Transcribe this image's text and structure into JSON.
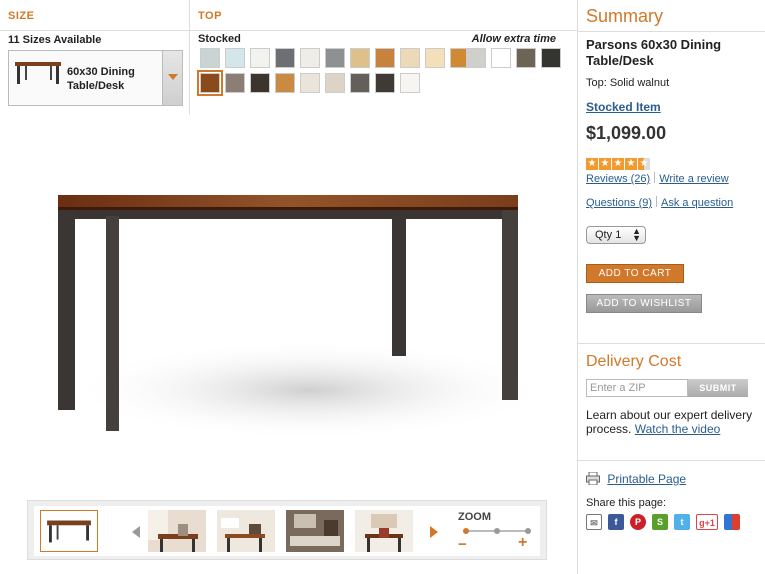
{
  "size": {
    "heading": "SIZE",
    "sub": "11 Sizes Available",
    "selected": "60x30 Dining Table/Desk"
  },
  "top": {
    "heading": "TOP",
    "stocked_label": "Stocked",
    "extra_label": "Allow extra time",
    "swatch_colors_row1": [
      "#c9d4d4",
      "#d3e6ea",
      "#f2f2ee",
      "#6d6f72",
      "#efede8",
      "#8e9194",
      "#e0c08a",
      "#c9823c",
      "#ecd9b5",
      "#f3dfb8",
      "#d08a34"
    ],
    "swatch_colors_row2": [
      "#8b4a1c",
      "#8c7e76",
      "#3d342e",
      "#c98a44",
      "#ebe4da",
      "#ddd4c7",
      "#63605c",
      "#3f3a36",
      "#f7f5f2"
    ],
    "swatch_colors_extra": [
      "#cfcfcb",
      "#ffffff",
      "#6d6455",
      "#343430"
    ]
  },
  "summary": {
    "heading": "Summary",
    "title": "Parsons 60x30 Dining Table/Desk",
    "top_info": "Top:  Solid walnut",
    "stocked_item": "Stocked Item",
    "price": "$1,099.00",
    "rating": 4.5,
    "reviews": "Reviews (26)",
    "write_review": "Write a review",
    "questions": "Questions (9)",
    "ask_question": "Ask a question",
    "qty_label": "Qty",
    "qty_value": "1",
    "add_to_cart": "ADD TO CART",
    "add_to_wishlist": "ADD TO WISHLIST"
  },
  "delivery": {
    "heading": "Delivery Cost",
    "zip_placeholder": "Enter a ZIP",
    "submit": "SUBMIT",
    "learn_text": "Learn about our expert delivery process.",
    "watch_link": "Watch the video"
  },
  "share": {
    "printable": "Printable Page",
    "label": "Share this page:",
    "icons": [
      "mail-icon",
      "facebook-icon",
      "pinterest-icon",
      "stumbleupon-icon",
      "twitter-icon",
      "google-plus-icon",
      "delicious-icon"
    ]
  },
  "zoom": {
    "label": "ZOOM",
    "minus": "−",
    "plus": "+"
  }
}
